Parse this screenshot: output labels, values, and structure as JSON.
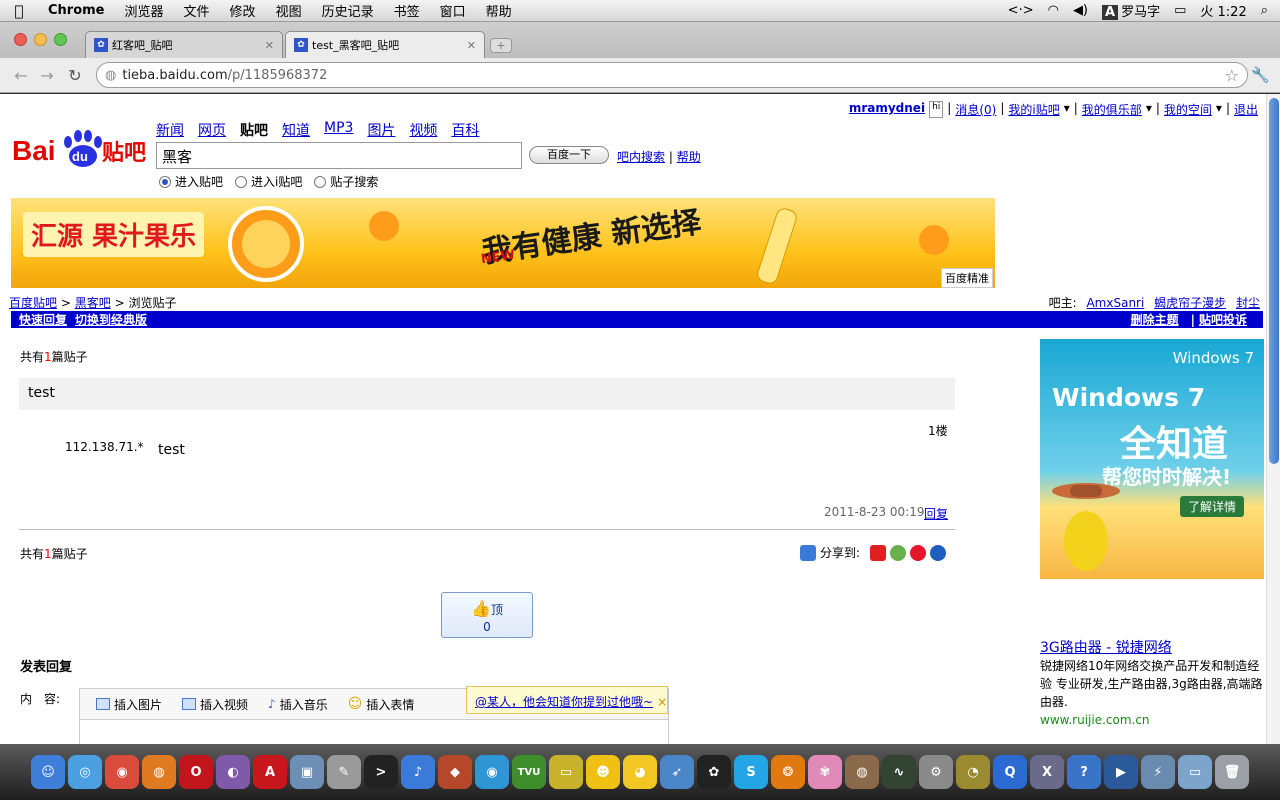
{
  "menubar": {
    "app": "Chrome",
    "items": [
      "浏览器",
      "文件",
      "修改",
      "视图",
      "历史记录",
      "书签",
      "窗口",
      "帮助"
    ],
    "input_method": "罗马字",
    "clock": "火 1:22"
  },
  "tabs": [
    {
      "label": "红客吧_贴吧"
    },
    {
      "label": "test_黑客吧_贴吧"
    }
  ],
  "address": {
    "host": "tieba.baidu.com",
    "path": "/p/1185968372"
  },
  "userbar": {
    "username": "mramydnei",
    "messages": "消息(0)",
    "my_tieba": "我的i贴吧",
    "my_club": "我的俱乐部",
    "my_space": "我的空间",
    "logout": "退出"
  },
  "logo": {
    "text": "Bai du 贴吧"
  },
  "topnav": [
    "新闻",
    "网页",
    "贴吧",
    "知道",
    "MP3",
    "图片",
    "视频",
    "百科"
  ],
  "search": {
    "value": "黑客",
    "button": "百度一下",
    "link_inbar": "吧内搜索",
    "link_help": "帮助",
    "radios": [
      "进入贴吧",
      "进入i贴吧",
      "贴子搜索"
    ]
  },
  "banner": {
    "brand": "汇源 果汁果乐",
    "slogan": "我有健康 新选择",
    "slogan_en": "NEW",
    "tag": "百度精准"
  },
  "breadcrumb": {
    "home": "百度贴吧",
    "forum": "黑客吧",
    "current": "> 浏览贴子",
    "sep": ">"
  },
  "owners": {
    "label": "吧主:",
    "names": [
      "AmxSanri",
      "蝎虎帘子漫步",
      "封尘"
    ]
  },
  "bluebar": {
    "quick_reply": "快速回复",
    "classic": "切换到经典版",
    "delete": "删除主题",
    "complain": "贴吧投诉",
    "sep": "|"
  },
  "thread": {
    "count_pre": "共有",
    "count_n": "1",
    "count_post": "篇贴子",
    "title": "test",
    "floor": "1楼",
    "ip": "112.138.71.*",
    "content": "test",
    "time": "2011-8-23 00:19",
    "reply": "回复",
    "share_label": "分享到:",
    "like_label": "顶",
    "like_count": "0"
  },
  "post": {
    "heading": "发表回复",
    "content_label": "内　容:",
    "tools": [
      "插入图片",
      "插入视频",
      "插入音乐",
      "插入表情"
    ],
    "mention_tip": "@某人，他会知道你提到过他哦~",
    "mention_close": "×"
  },
  "ads": {
    "win_logo": "Windows 7",
    "win_title": "Windows 7",
    "win_big": "全知道",
    "win_sub": "帮您时时解决!",
    "win_btn": "了解详情",
    "text_title": "3G路由器 - 锐捷网络",
    "text_body": "锐捷网络10年网络交换产品开发和制造经验 专业研发,生产路由器,3g路由器,高端路由器.",
    "text_url": "www.ruijie.com.cn"
  },
  "dock": {
    "icons": [
      {
        "name": "finder-icon",
        "glyph": "☺",
        "color": "#3d7fd8"
      },
      {
        "name": "safari-icon",
        "glyph": "◎",
        "color": "#4aa0e0"
      },
      {
        "name": "chrome-icon",
        "glyph": "◉",
        "color": "#d94b3a"
      },
      {
        "name": "firefox-icon",
        "glyph": "◍",
        "color": "#e07a20"
      },
      {
        "name": "opera-icon",
        "glyph": "O",
        "color": "#c2161c"
      },
      {
        "name": "tor-icon",
        "glyph": "◐",
        "color": "#7f5aa8"
      },
      {
        "name": "acrobat-icon",
        "glyph": "A",
        "color": "#c8161d"
      },
      {
        "name": "preview-icon",
        "glyph": "▣",
        "color": "#6e8fb5"
      },
      {
        "name": "scripteditor-icon",
        "glyph": "✎",
        "color": "#9a9a9a"
      },
      {
        "name": "terminal-icon",
        "glyph": ">",
        "color": "#222222"
      },
      {
        "name": "itunes-icon",
        "glyph": "♪",
        "color": "#3c7ad8"
      },
      {
        "name": "cyberduck-icon",
        "glyph": "◆",
        "color": "#b5472a"
      },
      {
        "name": "qq-browser-icon",
        "glyph": "◉",
        "color": "#2f96d6"
      },
      {
        "name": "tvu-icon",
        "glyph": "TVU",
        "color": "#3e8f2b"
      },
      {
        "name": "drive-icon",
        "glyph": "▭",
        "color": "#c9b22b"
      },
      {
        "name": "yahoo-messenger-icon",
        "glyph": "☻",
        "color": "#f0c012"
      },
      {
        "name": "adium-icon",
        "glyph": "◕",
        "color": "#f2c623"
      },
      {
        "name": "bird-icon",
        "glyph": "➶",
        "color": "#4a86c8"
      },
      {
        "name": "qq-icon",
        "glyph": "✿",
        "color": "#222222"
      },
      {
        "name": "skype-icon",
        "glyph": "S",
        "color": "#24a6e6"
      },
      {
        "name": "toucan-icon",
        "glyph": "❂",
        "color": "#e07a10"
      },
      {
        "name": "flower-icon",
        "glyph": "✾",
        "color": "#e08ab8"
      },
      {
        "name": "tortoise-icon",
        "glyph": "◍",
        "color": "#8a6a4a"
      },
      {
        "name": "activity-monitor-icon",
        "glyph": "∿",
        "color": "#334433"
      },
      {
        "name": "sysprefs-icon",
        "glyph": "⚙",
        "color": "#8a8a8a"
      },
      {
        "name": "clock-icon",
        "glyph": "◔",
        "color": "#9a8a30"
      },
      {
        "name": "quicktime-icon",
        "glyph": "Q",
        "color": "#2b6ad0"
      },
      {
        "name": "x11-icon",
        "glyph": "X",
        "color": "#6a6a8a"
      },
      {
        "name": "help-icon",
        "glyph": "?",
        "color": "#3a74c8"
      },
      {
        "name": "video-icon",
        "glyph": "▶",
        "color": "#2a5a9a"
      },
      {
        "name": "network-icon",
        "glyph": "⚡",
        "color": "#6a8ab0"
      },
      {
        "name": "folder-icon",
        "glyph": "▭",
        "color": "#7fa4cc"
      },
      {
        "name": "trash-icon",
        "glyph": "🗑",
        "color": "#9aa0a6"
      }
    ]
  }
}
